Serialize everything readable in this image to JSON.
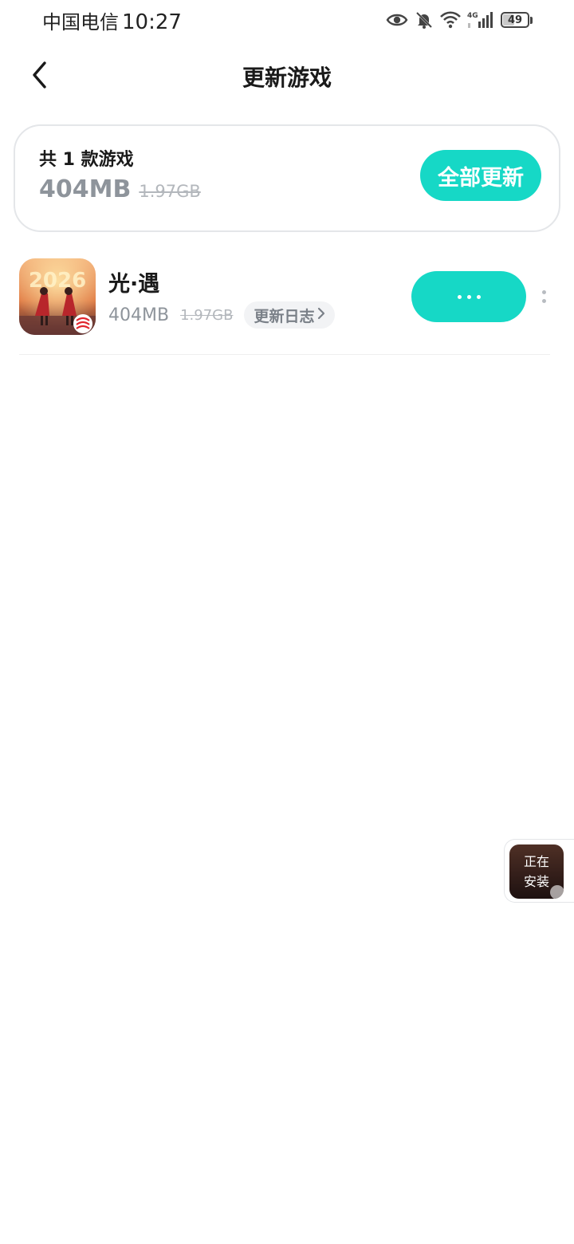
{
  "status_bar": {
    "carrier": "中国电信",
    "time": "10:27",
    "battery": "49",
    "battery_level": 0.49,
    "network_label": "4G",
    "icons": [
      "eye-icon",
      "bell-off-icon",
      "wifi-icon",
      "signal-icon",
      "battery-icon"
    ]
  },
  "header": {
    "title": "更新游戏",
    "back_icon": "chevron-left-icon"
  },
  "summary": {
    "count_label": "共 1 款游戏",
    "size": "404MB",
    "original_size": "1.97GB",
    "update_all_label": "全部更新"
  },
  "games": [
    {
      "name": "光·遇",
      "size": "404MB",
      "original_size": "1.97GB",
      "changelog_label": "更新日志",
      "action_state": "in-progress",
      "action_icon": "ellipsis-icon",
      "more_icon": "more-vertical-icon"
    }
  ],
  "install_float": {
    "line1": "正在",
    "line2": "安装"
  },
  "colors": {
    "accent": "#16d8c6",
    "muted_text": "#8e949b",
    "strikethrough_text": "#b3b7bc",
    "card_border": "#e4e6e9"
  }
}
